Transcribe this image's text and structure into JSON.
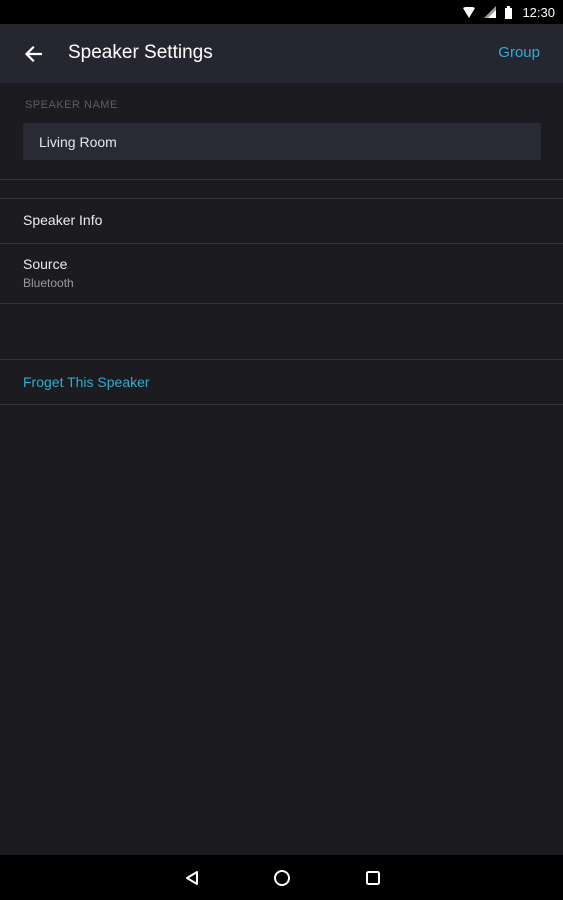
{
  "status_bar": {
    "time": "12:30",
    "icons": [
      "wifi-icon",
      "signal-icon",
      "battery-icon"
    ]
  },
  "app_bar": {
    "title": "Speaker Settings",
    "back_icon": "back-arrow-icon",
    "action_label": "Group"
  },
  "speaker_name": {
    "section_label": "SPEAKER NAME",
    "value": "Living Room"
  },
  "settings_items": [
    {
      "title": "Speaker Info"
    },
    {
      "title": "Source",
      "subtitle": "Bluetooth"
    }
  ],
  "forget": {
    "label": "Froget This Speaker"
  },
  "nav_bar": {
    "icons": [
      "back-triangle-icon",
      "home-circle-icon",
      "recents-square-icon"
    ]
  },
  "colors": {
    "background": "#1b1b20",
    "app_bar": "#262630",
    "accent": "#2eaed1",
    "field": "#2a2a34"
  }
}
